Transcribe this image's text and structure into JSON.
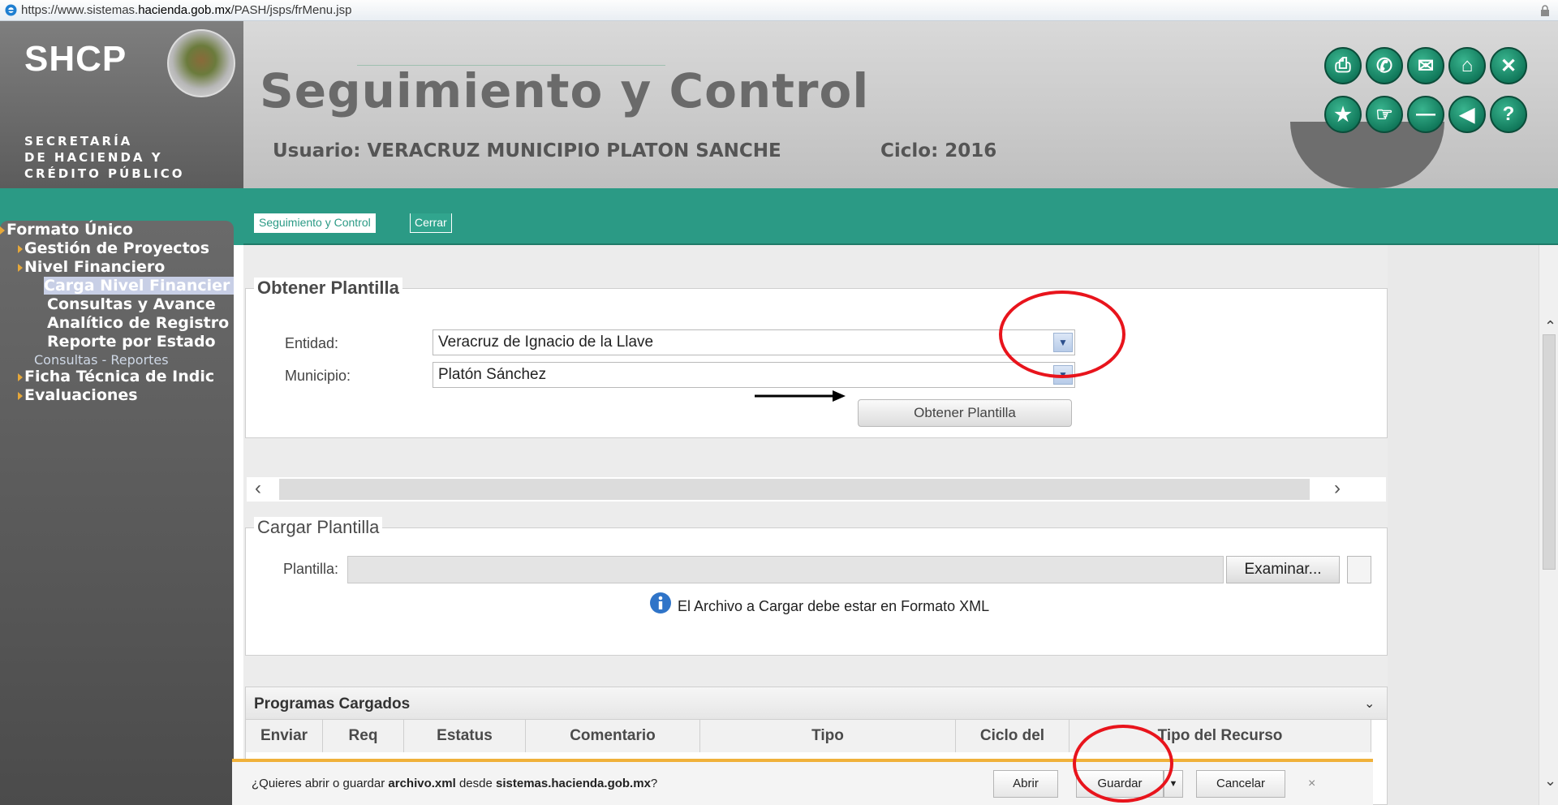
{
  "browser": {
    "url_prefix": "https://www.sistemas.",
    "url_domain": "hacienda.gob.mx",
    "url_path": "/PASH/jsps/frMenu.jsp"
  },
  "header": {
    "logo": "SHCP",
    "subtitle_line1": "SECRETARÍA",
    "subtitle_line2": "DE HACIENDA Y",
    "subtitle_line3": "CRÉDITO PÚBLICO",
    "title": "Seguimiento y Control",
    "usuario": "Usuario: VERACRUZ MUNICIPIO PLATON SANCHE",
    "ciclo": "Ciclo: 2016",
    "icons_row1": [
      "print-icon",
      "phone-icon",
      "mail-icon",
      "home-icon",
      "close-icon"
    ],
    "icons_row2": [
      "folder-icon",
      "hand-icon",
      "minus-icon",
      "back-icon",
      "help-icon"
    ]
  },
  "tabs": [
    {
      "label": "Seguimiento y Control"
    },
    {
      "label": "Cerrar"
    }
  ],
  "sidebar": {
    "items": [
      {
        "label": "Formato Único"
      },
      {
        "label": "Gestión de Proyectos"
      },
      {
        "label": "Nivel Financiero"
      },
      {
        "label": "Carga Nivel Financier"
      },
      {
        "label": "Consultas y Avance"
      },
      {
        "label": "Analítico de Registro"
      },
      {
        "label": "Reporte por Estado"
      },
      {
        "label": "Consultas - Reportes"
      },
      {
        "label": "Ficha Técnica de Indic"
      },
      {
        "label": "Evaluaciones"
      }
    ]
  },
  "obtener": {
    "legend": "Obtener Plantilla",
    "entidad_label": "Entidad:",
    "entidad_value": "Veracruz de Ignacio de la Llave",
    "municipio_label": "Municipio:",
    "municipio_value": "Platón Sánchez",
    "button": "Obtener Plantilla"
  },
  "cargar": {
    "legend": "Cargar Plantilla",
    "plantilla_label": "Plantilla:",
    "browse_button": "Examinar...",
    "info_text": "El Archivo a Cargar debe estar en Formato XML"
  },
  "programas": {
    "title": "Programas Cargados",
    "columns": [
      "Enviar",
      "Req",
      "Estatus",
      "Comentario",
      "Tipo",
      "Ciclo del",
      "Tipo del Recurso"
    ]
  },
  "download_bar": {
    "msg_prefix": "¿Quieres abrir o guardar ",
    "file": "archivo.xml",
    "msg_mid": " desde ",
    "site": "sistemas.hacienda.gob.mx",
    "msg_suffix": "?",
    "open": "Abrir",
    "save": "Guardar",
    "cancel": "Cancelar",
    "close": "×"
  },
  "colors": {
    "teal": "#2b9a85",
    "annotation_red": "#e8141c",
    "download_accent": "#f0b13a"
  }
}
